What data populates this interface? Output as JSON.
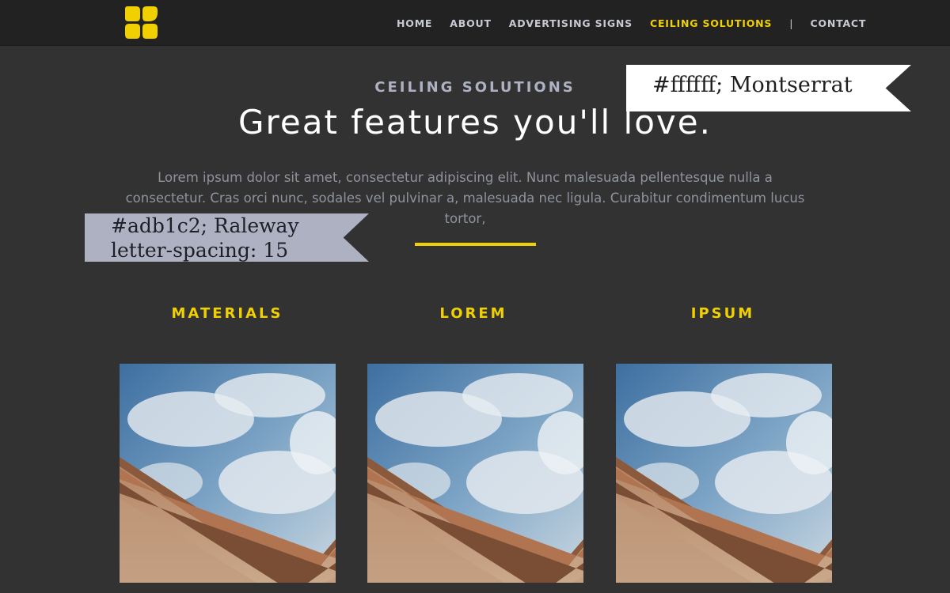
{
  "nav": {
    "items": [
      {
        "label": "HOME",
        "active": false
      },
      {
        "label": "ABOUT",
        "active": false
      },
      {
        "label": "ADVERTISING SIGNS",
        "active": false
      },
      {
        "label": "CEILING SOLUTIONS",
        "active": true
      },
      {
        "label": "CONTACT",
        "active": false
      }
    ],
    "separator": "|"
  },
  "hero": {
    "eyebrow": "CEILING SOLUTIONS",
    "headline": "Great features you'll love.",
    "intro": "Lorem ipsum dolor sit amet, consectetur adipiscing elit. Nunc malesuada pellentesque nulla a consectetur. Cras orci nunc, sodales vel pulvinar a, malesuada nec ligula. Curabitur condimentum lucus tortor,"
  },
  "annotations": {
    "white_flag": "#ffffff; Montserrat",
    "lavender_flag_line1": "#adb1c2; Raleway",
    "lavender_flag_line2": "letter-spacing: 15"
  },
  "features": [
    {
      "title": "MATERIALS"
    },
    {
      "title": "LOREM"
    },
    {
      "title": "IPSUM"
    }
  ],
  "colors": {
    "background": "#323232",
    "navbar": "#222222",
    "accent": "#f0d000",
    "eyebrow": "#adb1c2",
    "headline": "#ffffff",
    "body_text": "#8f939d"
  },
  "icons": {
    "logo": "yellow-four-petal-logo-icon"
  }
}
